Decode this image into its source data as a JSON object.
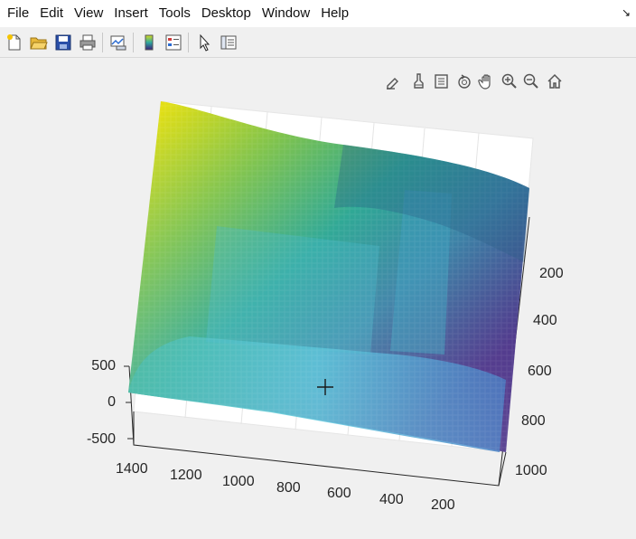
{
  "menubar": {
    "items": [
      {
        "label": "File"
      },
      {
        "label": "Edit"
      },
      {
        "label": "View"
      },
      {
        "label": "Insert"
      },
      {
        "label": "Tools"
      },
      {
        "label": "Desktop"
      },
      {
        "label": "Window"
      },
      {
        "label": "Help"
      }
    ],
    "dock_arrow": "↘"
  },
  "toolbar": {
    "buttons": [
      {
        "icon": "new-figure-icon"
      },
      {
        "icon": "open-file-icon"
      },
      {
        "icon": "save-icon"
      },
      {
        "icon": "print-icon"
      },
      {
        "icon": "link-plot-icon"
      },
      {
        "icon": "insert-colorbar-icon"
      },
      {
        "icon": "insert-legend-icon"
      },
      {
        "icon": "edit-plot-arrow-icon"
      },
      {
        "icon": "property-inspector-icon"
      }
    ]
  },
  "axes_toolbar": {
    "buttons": [
      {
        "icon": "brush-edit-icon"
      },
      {
        "icon": "data-brush-icon"
      },
      {
        "icon": "datatip-icon"
      },
      {
        "icon": "rotate-3d-icon"
      },
      {
        "icon": "pan-hand-icon"
      },
      {
        "icon": "zoom-in-icon"
      },
      {
        "icon": "zoom-out-icon"
      },
      {
        "icon": "home-restore-icon"
      }
    ]
  },
  "axes": {
    "z_ticks": [
      "500",
      "0",
      "-500"
    ],
    "x_ticks": [
      "1400",
      "1200",
      "1000",
      "800",
      "600",
      "400",
      "200"
    ],
    "y_ticks": [
      "200",
      "400",
      "600",
      "800",
      "1000"
    ]
  },
  "colors": {
    "surface_top": "#d7dc1e",
    "surface_mid": "#2fa9a0",
    "surface_deep": "#3b1d7a",
    "surface_light": "#5fd6e6"
  }
}
